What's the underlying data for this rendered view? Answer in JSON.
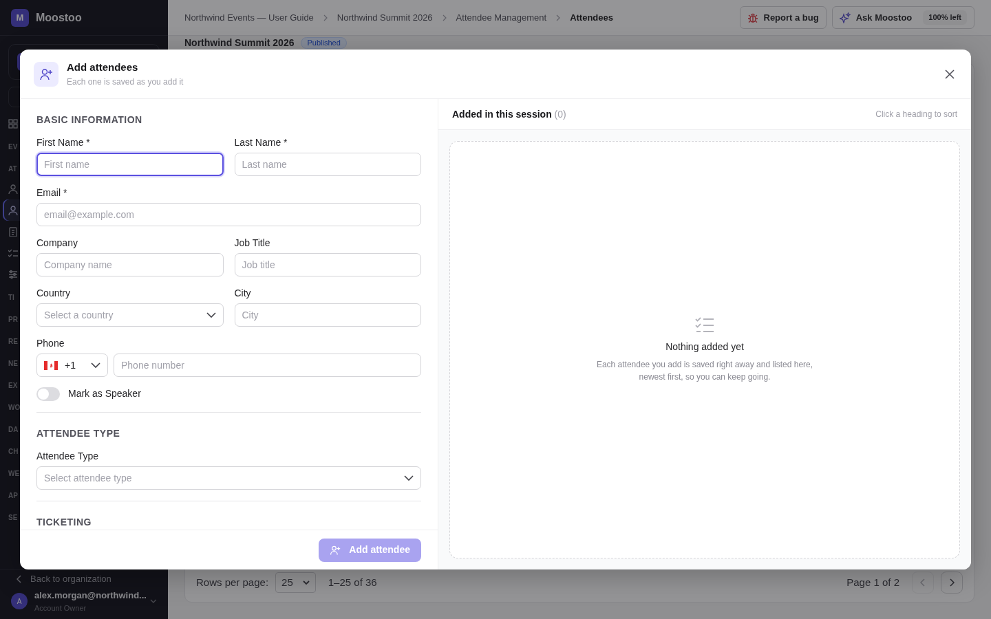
{
  "app": {
    "logo_letter": "M",
    "name": "Moostoo"
  },
  "sidebar": {
    "items": [
      {
        "kind": "link",
        "selected": false
      },
      {
        "kind": "section",
        "label": "EV"
      },
      {
        "kind": "section",
        "label": "AT"
      },
      {
        "kind": "link",
        "selected": false
      },
      {
        "kind": "link",
        "selected": true
      },
      {
        "kind": "link",
        "selected": false
      },
      {
        "kind": "link",
        "selected": false
      },
      {
        "kind": "link",
        "selected": false
      },
      {
        "kind": "section",
        "label": "TI"
      },
      {
        "kind": "section",
        "label": "PR"
      },
      {
        "kind": "section",
        "label": "RE"
      },
      {
        "kind": "section",
        "label": "NE"
      },
      {
        "kind": "section",
        "label": "EX"
      },
      {
        "kind": "section",
        "label": "WO"
      },
      {
        "kind": "section",
        "label": "DA"
      },
      {
        "kind": "section",
        "label": "CH"
      },
      {
        "kind": "section",
        "label": "WE"
      },
      {
        "kind": "section",
        "label": "AP"
      },
      {
        "kind": "section",
        "label": "SE"
      }
    ],
    "back_link": "Back to organization",
    "user": {
      "avatar_letter": "A",
      "email": "alex.morgan@northwind...",
      "role": "Account Owner"
    }
  },
  "breadcrumbs": [
    {
      "label": "Northwind Events — User Guide",
      "current": false
    },
    {
      "label": "Northwind Summit 2026",
      "current": false
    },
    {
      "label": "Attendee Management",
      "current": false
    },
    {
      "label": "Attendees",
      "current": true
    }
  ],
  "header_buttons": {
    "report": "Report a bug",
    "ask": "Ask Moostoo",
    "ask_badge": "100% left"
  },
  "page": {
    "title": "Northwind Summit 2026",
    "status": "Published"
  },
  "pagination": {
    "rows_label": "Rows per page:",
    "rows_value": "25",
    "range": "1–25 of 36",
    "page": "Page 1 of 2",
    "prev_disabled": true,
    "next_disabled": false
  },
  "modal": {
    "title": "Add attendees",
    "subtitle": "Each one is saved as you add it",
    "sections": [
      {
        "title": "BASIC INFORMATION",
        "rows": [
          [
            {
              "kind": "text",
              "label": "First Name *",
              "placeholder": "First name",
              "focused": true
            },
            {
              "kind": "text",
              "label": "Last Name *",
              "placeholder": "Last name",
              "focused": false
            }
          ],
          [
            {
              "kind": "text",
              "label": "Email *",
              "placeholder": "email@example.com",
              "focused": false
            }
          ],
          [
            {
              "kind": "text",
              "label": "Company",
              "placeholder": "Company name",
              "focused": false
            },
            {
              "kind": "text",
              "label": "Job Title",
              "placeholder": "Job title",
              "focused": false
            }
          ],
          [
            {
              "kind": "select",
              "label": "Country",
              "placeholder": "Select a country"
            },
            {
              "kind": "text",
              "label": "City",
              "placeholder": "City",
              "focused": false
            }
          ],
          [
            {
              "kind": "phone",
              "label": "Phone",
              "code": "+1",
              "placeholder": "Phone number"
            }
          ],
          [
            {
              "kind": "toggle",
              "label": "Mark as Speaker",
              "on": false
            }
          ]
        ]
      },
      {
        "title": "ATTENDEE TYPE",
        "rows": [
          [
            {
              "kind": "select",
              "label": "Attendee Type",
              "placeholder": "Select attendee type"
            }
          ]
        ]
      },
      {
        "title": "TICKETING"
      }
    ],
    "submit": {
      "label": "Add attendee",
      "disabled": true
    },
    "session": {
      "title": "Added in this session",
      "count": "(0)",
      "hint": "Click a heading to sort",
      "empty_title": "Nothing added yet",
      "empty_text": "Each attendee you add is saved right away and listed here, newest first, so you can keep going."
    }
  }
}
